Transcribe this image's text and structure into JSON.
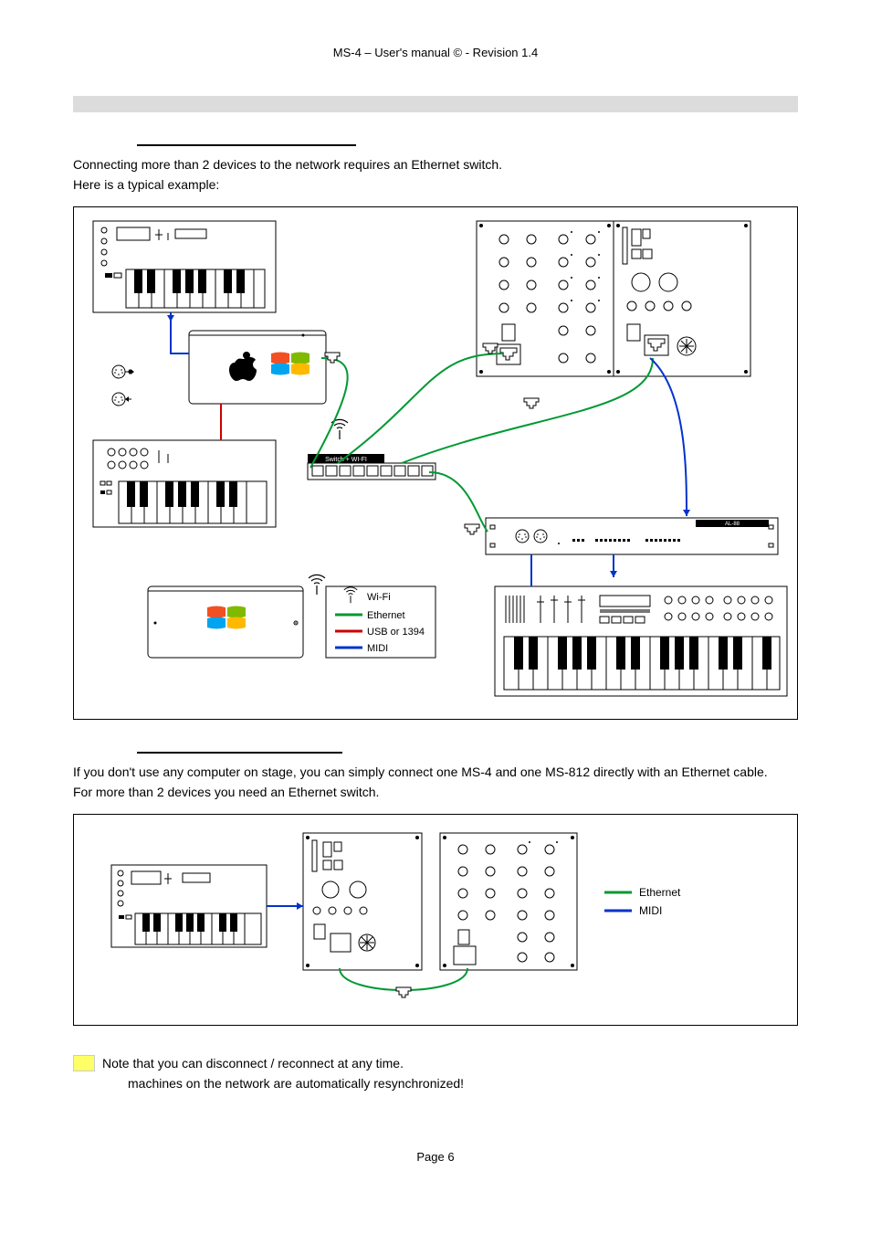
{
  "header": "MS-4   – User's manual ©   -   Revision 1.4",
  "sec1_intro1": "Connecting more than 2 devices to the network requires an Ethernet switch.",
  "sec1_intro2": "Here is a typical example:",
  "diagram1": {
    "switch_label": "Switch + WI-FI",
    "al88": "AL-88",
    "legend": {
      "wifi": "Wi-Fi",
      "ethernet": "Ethernet",
      "usb": "USB or 1394",
      "midi": "MIDI"
    }
  },
  "sec2_intro1": "If you don't use any computer on stage, you can simply connect one MS-4 and one MS-812 directly with an Ethernet cable.",
  "sec2_intro2": "For more than 2 devices you need an Ethernet switch.",
  "diagram2": {
    "legend": {
      "ethernet": "Ethernet",
      "midi": "MIDI"
    }
  },
  "note_line1": "Note that you can disconnect / reconnect at any time.",
  "note_line2": "machines on the network are automatically resynchronized!",
  "footer": "Page 6"
}
